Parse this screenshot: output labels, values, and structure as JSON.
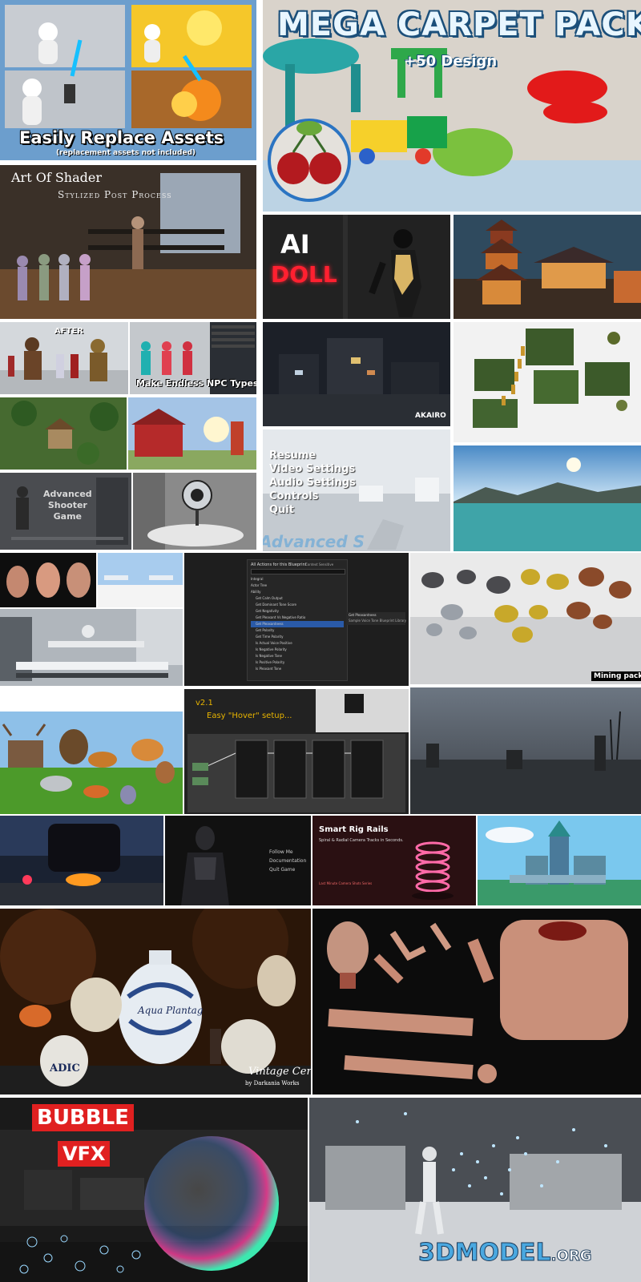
{
  "replace": {
    "title": "Easily Replace Assets",
    "subtitle": "(replacement assets not included)"
  },
  "carpet": {
    "title": "MEGA CARPET PACK",
    "subtitle": "+50 Design"
  },
  "shader": {
    "title": "Art Of Shader",
    "subtitle": "Stylized Post Process"
  },
  "ai_doll": {
    "line1": "AI",
    "line2": "DOLL"
  },
  "npc": {
    "after": "AFTER",
    "caption": "Make Endless NPC Types"
  },
  "akairo": {
    "label": "AKAIRO"
  },
  "menu": {
    "items": [
      "Resume",
      "Video Settings",
      "Audio Settings",
      "Controls",
      "Quit"
    ],
    "watermark": "Advanced S"
  },
  "shooter": {
    "line1": "Advanced",
    "line2": "Shooter",
    "line3": "Game"
  },
  "blueprint": {
    "header": "All Actions for this Blueprint",
    "context": "Context Sensitive",
    "items": [
      "Integral",
      "Actor Tree",
      "Ability",
      "Get Calm Output",
      "Get Dominant Tone Score",
      "Get Negativity",
      "Get Pleasant Vs Negative Ratio",
      "Get Pleasantness",
      "Get Polarity",
      "Get Time Polarity",
      "Is Actual Voice Positive",
      "Is Negative Polarity",
      "Is Negative Tone",
      "Is Positive Polarity",
      "Is Pleasant Tone"
    ],
    "side1": "Get Pleasantness",
    "side2": "Sample Voice Tone Blueprint Library"
  },
  "mining": {
    "label": "Mining pack"
  },
  "hover": {
    "version": "v2.1",
    "title": "Easy \"Hover\" setup..."
  },
  "follow": {
    "items": [
      "Follow Me",
      "Documentation",
      "Quit Game"
    ]
  },
  "rig": {
    "title": "Smart Rig Rails",
    "subtitle": "Spiral & Radial Camera Tracks in Seconds.",
    "footer": "Last Minute Camera Shots Series"
  },
  "ceramics": {
    "title": "Vintage Ceramics",
    "author": "by Darkania Works",
    "jar_label": "Aqua Plantag",
    "jar_label2": "ADIC"
  },
  "bubble": {
    "line1": "BUBBLE",
    "line2": "VFX"
  },
  "watermark": {
    "text": "3DMODEL",
    "suffix": ".ORG"
  },
  "colors": {
    "carpet_title": "#e8f6ff",
    "ai_red": "#ff2030",
    "bubble_red": "#e02020",
    "akairo_bg": "#1a1e26"
  }
}
